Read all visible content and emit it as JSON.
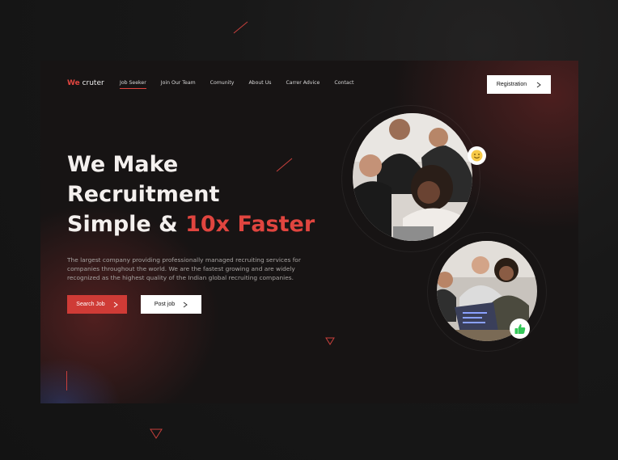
{
  "brand": {
    "accent": "We",
    "name": " cruter",
    "accent_color": "#e0453f"
  },
  "nav": {
    "items": [
      {
        "label": "Job Seeker",
        "active": true
      },
      {
        "label": "Join Our Team"
      },
      {
        "label": "Comunity"
      },
      {
        "label": "About Us"
      },
      {
        "label": "Carrer Advice"
      },
      {
        "label": "Contact"
      }
    ]
  },
  "header": {
    "registration_label": "Registration"
  },
  "hero": {
    "line1": "We Make",
    "line2": "Recruitment",
    "line3_prefix": "Simple & ",
    "line3_accent": "10x Faster",
    "description": "The largest company providing professionally managed recruiting services for companies throughout the world. We are the fastest growing and are widely recognized as the highest quality of the Indian global recruiting companies.",
    "search_label": "Search Job",
    "post_label": "Post job"
  },
  "icons": {
    "chevron": "chevron-right-icon",
    "smile": "smile-emoji-icon",
    "thumb": "thumbs-up-icon"
  }
}
